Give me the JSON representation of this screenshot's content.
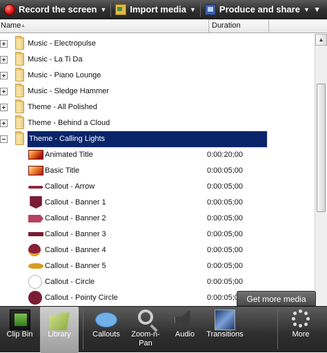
{
  "toolbar": {
    "record_label": "Record the screen",
    "import_label": "Import media",
    "produce_label": "Produce and share",
    "overflow_glyph": "▾"
  },
  "columns": {
    "name": "Name",
    "duration": "Duration"
  },
  "folders": [
    {
      "label": "Music - Electropulse",
      "expanded": false
    },
    {
      "label": "Music - La Ti Da",
      "expanded": false
    },
    {
      "label": "Music - Piano Lounge",
      "expanded": false
    },
    {
      "label": "Music - Sledge Hammer",
      "expanded": false
    },
    {
      "label": "Theme - All Polished",
      "expanded": false
    },
    {
      "label": "Theme - Behind a Cloud",
      "expanded": false
    },
    {
      "label": "Theme - Calling Lights",
      "expanded": true,
      "selected": true
    }
  ],
  "items": [
    {
      "label": "Animated Title",
      "duration": "0:00:20;00",
      "icon": "animated-title"
    },
    {
      "label": "Basic Title",
      "duration": "0:00:05;00",
      "icon": "basic-title"
    },
    {
      "label": "Callout - Arrow",
      "duration": "0:00:05;00",
      "icon": "arrow"
    },
    {
      "label": "Callout - Banner 1",
      "duration": "0:00:05;00",
      "icon": "banner1"
    },
    {
      "label": "Callout - Banner 2",
      "duration": "0:00:05;00",
      "icon": "banner2"
    },
    {
      "label": "Callout - Banner 3",
      "duration": "0:00:05;00",
      "icon": "banner3"
    },
    {
      "label": "Callout - Banner 4",
      "duration": "0:00:05;00",
      "icon": "banner4"
    },
    {
      "label": "Callout - Banner 5",
      "duration": "0:00:05;00",
      "icon": "banner5"
    },
    {
      "label": "Callout - Circle",
      "duration": "0:00:05;00",
      "icon": "circle"
    },
    {
      "label": "Callout - Pointy Circle",
      "duration": "0:00:05;00",
      "icon": "pointy-circle"
    }
  ],
  "get_more_media": "Get more media",
  "tabs": {
    "clip_bin": "Clip Bin",
    "library": "Library",
    "callouts": "Callouts",
    "zoom_line1": "Zoom-n-",
    "zoom_line2": "Pan",
    "audio": "Audio",
    "transitions": "Transitions",
    "more": "More"
  },
  "active_tab": "library"
}
